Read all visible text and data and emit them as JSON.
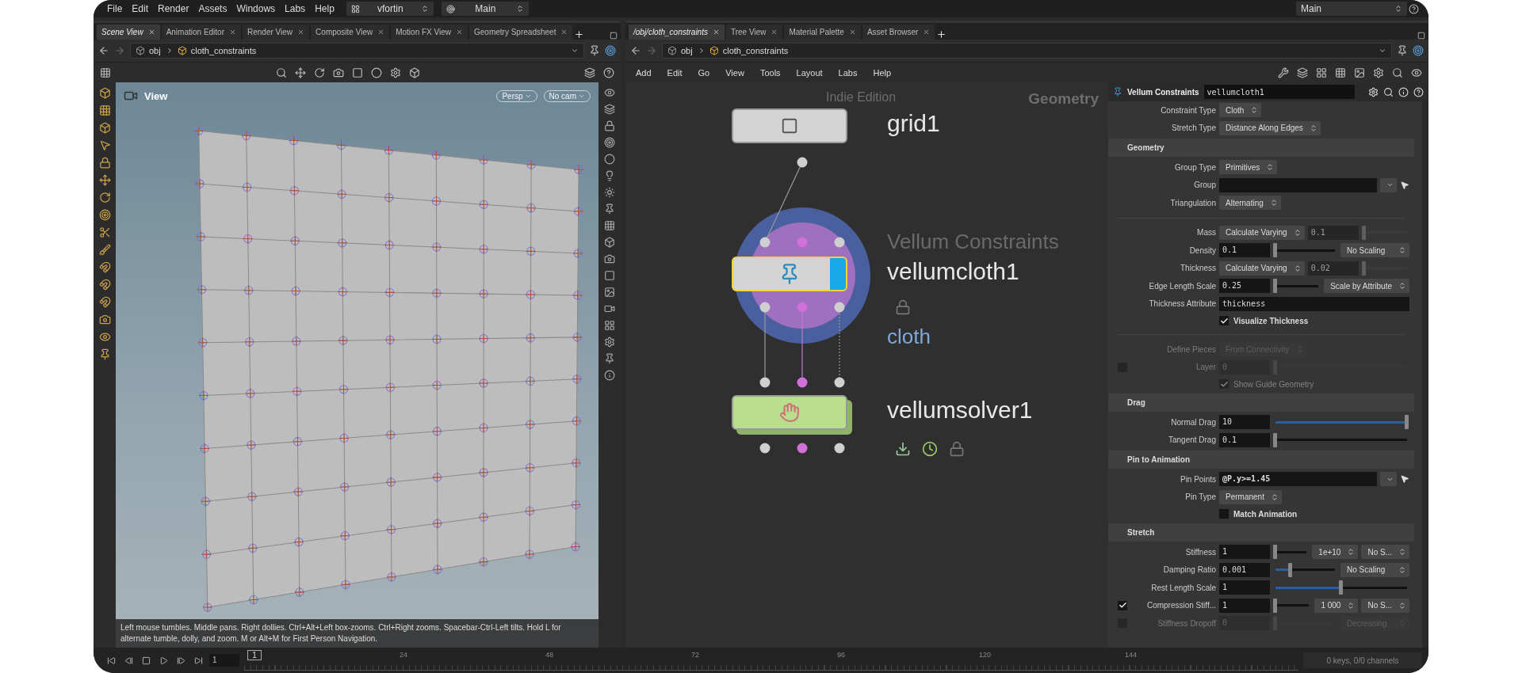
{
  "menubar": {
    "items": [
      "File",
      "Edit",
      "Render",
      "Assets",
      "Windows",
      "Labs",
      "Help"
    ],
    "desktop": "vfortin",
    "context": "Main",
    "right_context": "Main"
  },
  "left_pane": {
    "tabs": [
      {
        "label": "Scene View",
        "selected": true
      },
      {
        "label": "Animation Editor",
        "selected": false
      },
      {
        "label": "Render View",
        "selected": false
      },
      {
        "label": "Composite View",
        "selected": false
      },
      {
        "label": "Motion FX View",
        "selected": false
      },
      {
        "label": "Geometry Spreadsheet",
        "selected": false
      }
    ],
    "path": [
      "obj",
      "cloth_constraints"
    ],
    "viewport": {
      "title": "View",
      "camera_buttons": [
        "Persp",
        "No cam"
      ],
      "hint": "Left mouse tumbles. Middle pans. Right dollies. Ctrl+Alt+Left box-zooms. Ctrl+Right zooms. Spacebar-Ctrl-Left tilts. Hold L for alternate tumble, dolly, and zoom. M or Alt+M for First Person Navigation."
    }
  },
  "right_pane": {
    "tabs": [
      {
        "label": "/obj/cloth_constraints",
        "selected": true
      },
      {
        "label": "Tree View",
        "selected": false
      },
      {
        "label": "Material Palette",
        "selected": false
      },
      {
        "label": "Asset Browser",
        "selected": false
      }
    ],
    "path": [
      "obj",
      "cloth_constraints"
    ],
    "menu": [
      "Add",
      "Edit",
      "Go",
      "View",
      "Tools",
      "Layout",
      "Labs",
      "Help"
    ],
    "network": {
      "edition": "Indie Edition",
      "context": "Geometry",
      "nodes": [
        {
          "kind": "grid",
          "name": "grid1",
          "selected": false
        },
        {
          "kind": "constraints",
          "name": "vellumcloth1",
          "type_label": "Vellum Constraints",
          "subtitle": "cloth",
          "selected": true
        },
        {
          "kind": "solver",
          "name": "vellumsolver1",
          "selected": false
        }
      ]
    }
  },
  "params": {
    "type": "Vellum Constraints",
    "name": "vellumcloth1",
    "rows": [
      {
        "kind": "row",
        "label": "Constraint Type",
        "disabled": false,
        "parts": [
          {
            "kind": "menu",
            "value": "Cloth",
            "disabled": false
          }
        ]
      },
      {
        "kind": "row",
        "label": "Stretch Type",
        "disabled": false,
        "parts": [
          {
            "kind": "menu",
            "value": "Distance Along Edges",
            "disabled": false
          }
        ]
      },
      {
        "kind": "section",
        "title": "Geometry"
      },
      {
        "kind": "row",
        "label": "Group Type",
        "disabled": false,
        "parts": [
          {
            "kind": "menu",
            "value": "Primitives",
            "disabled": false
          }
        ]
      },
      {
        "kind": "row",
        "label": "Group",
        "disabled": false,
        "parts": [
          {
            "kind": "string",
            "picker": true,
            "disabled": false
          }
        ]
      },
      {
        "kind": "row",
        "label": "Triangulation",
        "disabled": false,
        "parts": [
          {
            "kind": "menu",
            "value": "Alternating",
            "disabled": false
          }
        ]
      },
      {
        "kind": "divider"
      },
      {
        "kind": "row",
        "label": "Mass",
        "disabled": false,
        "parts": [
          {
            "kind": "menu",
            "value": "Calculate Varying",
            "disabled": false
          },
          {
            "kind": "field",
            "value": "0.1",
            "disabled": true
          },
          {
            "kind": "slider",
            "level": 0,
            "disabled": true
          }
        ]
      },
      {
        "kind": "row",
        "label": "Density",
        "disabled": false,
        "parts": [
          {
            "kind": "field",
            "value": "0.1",
            "disabled": false
          },
          {
            "kind": "slider",
            "level": 0,
            "disabled": false
          },
          {
            "kind": "menu",
            "value": "No Scaling",
            "disabled": false
          }
        ]
      },
      {
        "kind": "row",
        "label": "Thickness",
        "disabled": false,
        "parts": [
          {
            "kind": "menu",
            "value": "Calculate Varying",
            "disabled": false
          },
          {
            "kind": "field",
            "value": "0.02",
            "disabled": true
          },
          {
            "kind": "slider",
            "level": 0,
            "disabled": true
          }
        ]
      },
      {
        "kind": "row",
        "label": "Edge Length Scale",
        "disabled": false,
        "parts": [
          {
            "kind": "field",
            "value": "0.25",
            "disabled": false
          },
          {
            "kind": "slider",
            "level": 0,
            "disabled": false
          },
          {
            "kind": "menu",
            "value": "Scale by Attribute",
            "disabled": false
          }
        ]
      },
      {
        "kind": "row",
        "label": "Thickness Attribute",
        "disabled": false,
        "parts": [
          {
            "kind": "string",
            "value": "thickness",
            "picker": false,
            "disabled": false
          }
        ]
      },
      {
        "kind": "toggle",
        "label": "Visualize Thickness",
        "checked": true,
        "disabled": false
      },
      {
        "kind": "divider"
      },
      {
        "kind": "row",
        "label": "Define Pieces",
        "disabled": true,
        "parts": [
          {
            "kind": "menu",
            "value": "From Connectivity",
            "disabled": true
          }
        ]
      },
      {
        "kind": "row",
        "label": "Layer",
        "disabled": true,
        "toggle": false,
        "parts": [
          {
            "kind": "field",
            "value": "0",
            "disabled": true
          },
          {
            "kind": "slider",
            "level": 0,
            "disabled": true
          }
        ]
      },
      {
        "kind": "toggle",
        "label": "Show Guide Geometry",
        "checked": true,
        "disabled": true
      },
      {
        "kind": "section",
        "title": "Drag"
      },
      {
        "kind": "row",
        "label": "Normal Drag",
        "disabled": false,
        "parts": [
          {
            "kind": "field",
            "value": "10",
            "disabled": false
          },
          {
            "kind": "slider",
            "level": 1,
            "disabled": false
          }
        ]
      },
      {
        "kind": "row",
        "label": "Tangent Drag",
        "disabled": false,
        "parts": [
          {
            "kind": "field",
            "value": "0.1",
            "disabled": false
          },
          {
            "kind": "slider",
            "level": 0,
            "disabled": false
          }
        ]
      },
      {
        "kind": "section",
        "title": "Pin to Animation"
      },
      {
        "kind": "row",
        "label": "Pin Points",
        "disabled": false,
        "parts": [
          {
            "kind": "string",
            "value": "@P.y>=1.45",
            "picker": true,
            "disabled": false
          }
        ]
      },
      {
        "kind": "row",
        "label": "Pin Type",
        "disabled": false,
        "parts": [
          {
            "kind": "menu",
            "value": "Permanent",
            "disabled": false
          }
        ]
      },
      {
        "kind": "toggle",
        "label": "Match Animation",
        "checked": false,
        "disabled": false
      },
      {
        "kind": "section",
        "title": "Stretch"
      },
      {
        "kind": "row",
        "label": "Stiffness",
        "disabled": false,
        "parts": [
          {
            "kind": "field",
            "value": "1",
            "disabled": false
          },
          {
            "kind": "slider",
            "level": 0,
            "disabled": false
          },
          {
            "kind": "menu",
            "value": "1e+10",
            "disabled": false
          },
          {
            "kind": "menu",
            "value": "No S...",
            "disabled": false
          }
        ]
      },
      {
        "kind": "row",
        "label": "Damping Ratio",
        "disabled": false,
        "parts": [
          {
            "kind": "field",
            "value": "0.001",
            "disabled": false
          },
          {
            "kind": "slider",
            "level": 0.25,
            "disabled": false
          },
          {
            "kind": "menu",
            "value": "No Scaling",
            "disabled": false
          }
        ]
      },
      {
        "kind": "row",
        "label": "Rest Length Scale",
        "disabled": false,
        "parts": [
          {
            "kind": "field",
            "value": "1",
            "disabled": false
          },
          {
            "kind": "slider",
            "level": 0.5,
            "disabled": false
          }
        ]
      },
      {
        "kind": "row",
        "label": "Compression Stiff...",
        "disabled": false,
        "toggle": true,
        "parts": [
          {
            "kind": "field",
            "value": "1",
            "disabled": false
          },
          {
            "kind": "slider",
            "level": 0,
            "disabled": false
          },
          {
            "kind": "menu",
            "value": "1 000",
            "disabled": false
          },
          {
            "kind": "menu",
            "value": "No S...",
            "disabled": false
          }
        ]
      },
      {
        "kind": "row",
        "label": "Stiffness Dropoff",
        "disabled": true,
        "toggle": false,
        "parts": [
          {
            "kind": "field",
            "value": "0",
            "disabled": true
          },
          {
            "kind": "slider",
            "level": 0,
            "disabled": true
          },
          {
            "kind": "menu",
            "value": "Decreasing",
            "disabled": true
          }
        ]
      }
    ]
  },
  "timeline": {
    "frame": "1",
    "current": "1",
    "ticks": [
      "24",
      "48",
      "72",
      "96",
      "120",
      "144"
    ],
    "status": "0 keys, 0/0 channels"
  }
}
